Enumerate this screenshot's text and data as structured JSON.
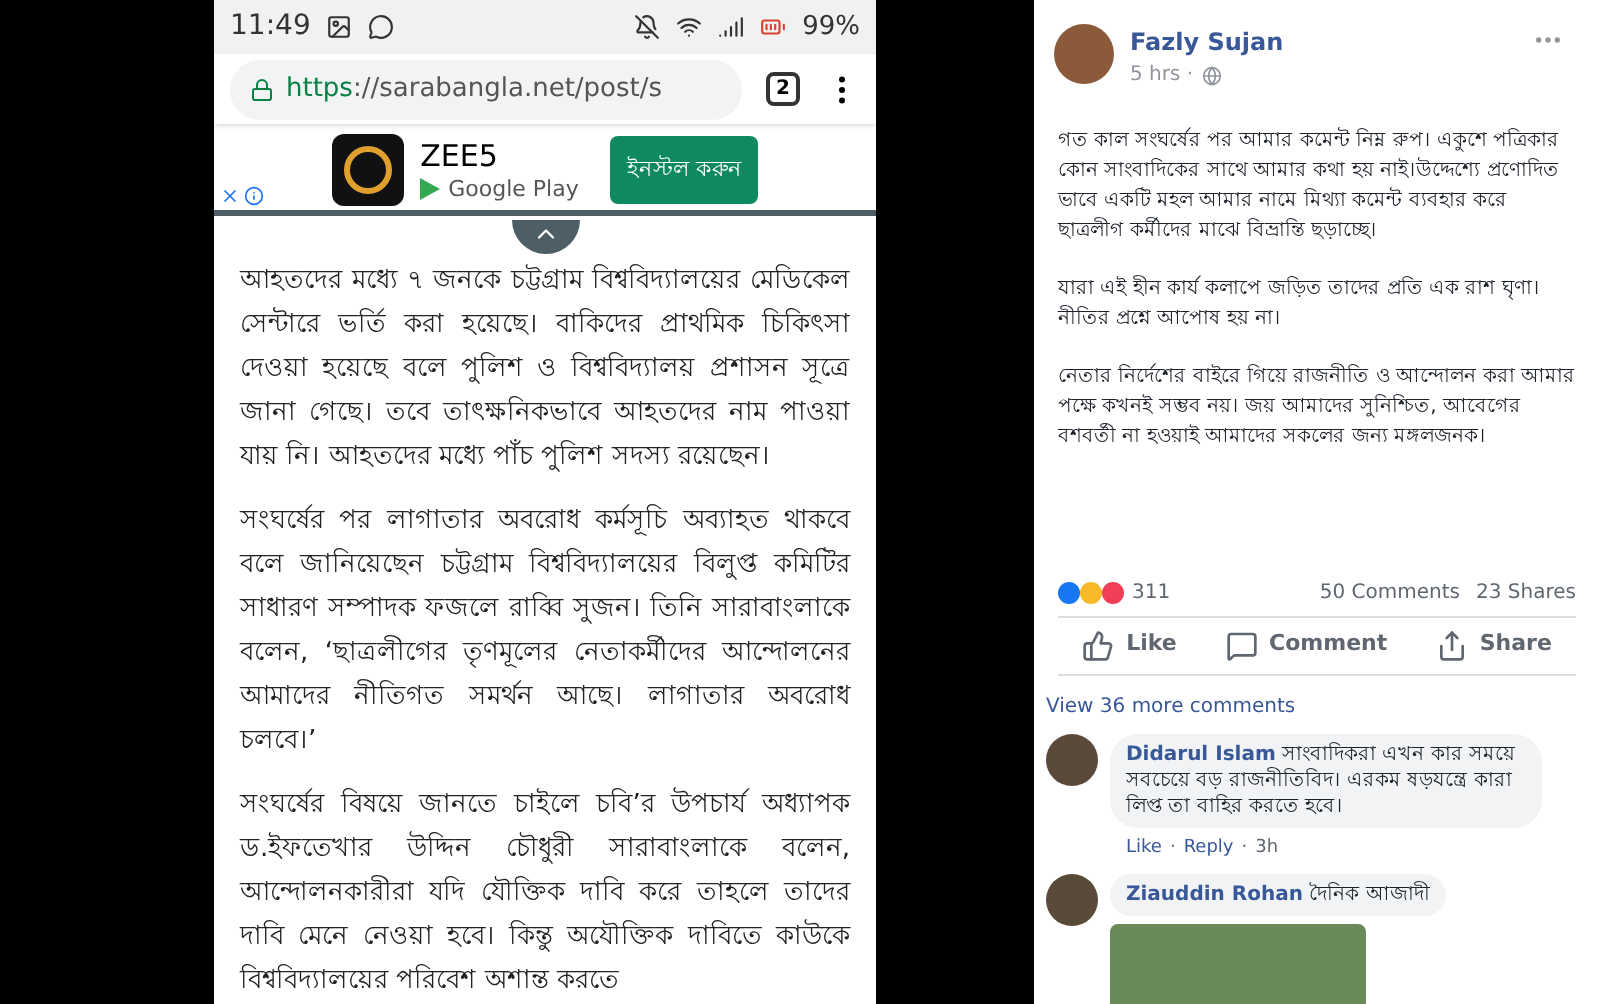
{
  "phone": {
    "status_bar": {
      "time": "11:49",
      "battery": "99%"
    },
    "browser": {
      "url_scheme": "https",
      "url_rest": "://sarabangla.net/post/s",
      "tab_count": "2"
    },
    "ad": {
      "app_name": "ZEE5",
      "store": "Google Play",
      "install_label": "ইনস্টল করুন"
    },
    "paragraphs": [
      "আহতদের মধ্যে ৭ জনকে চট্টগ্রাম বিশ্ববিদ্যালয়ের মেডিকেল সেন্টারে ভর্তি করা হয়েছে। বাকিদের প্রাথমিক চিকিৎসা দেওয়া হয়েছে বলে পুলিশ ও বিশ্ববিদ্যালয় প্রশাসন সূত্রে জানা গেছে। তবে তাৎক্ষনিকভাবে আহতদের নাম পাওয়া যায় নি। আহতদের মধ্যে পাঁচ পুলিশ সদস্য রয়েছেন।",
      "সংঘর্ষের পর লাগাতার অবরোধ কর্মসূচি অব্যাহত থাকবে বলে জানিয়েছেন চট্টগ্রাম বিশ্ববিদ্যালয়ের বিলুপ্ত কমিটির সাধারণ সম্পাদক ফজলে রাব্বি সুজন। তিনি সারাবাংলাকে বলেন, ‘ছাত্রলীগের তৃণমূলের নেতাকর্মীদের আন্দোলনের আমাদের নীতিগত সমর্থন আছে। লাগাতার অবরোধ চলবে।’",
      "সংঘর্ষের বিষয়ে জানতে চাইলে চবি’র উপচার্য অধ্যাপক ড.ইফতেখার উদ্দিন চৌধুরী সারাবাংলাকে বলেন, আন্দোলনকারীরা যদি যৌক্তিক দাবি করে তাহলে তাদের দাবি মেনে নেওয়া হবে। কিন্তু অযৌক্তিক দাবিতে কাউকে বিশ্ববিদ্যালয়ের পরিবেশ অশান্ত করতে"
    ]
  },
  "post": {
    "author": "Fazly Sujan",
    "time": "5 hrs ·",
    "paragraphs": [
      "গত কাল সংঘর্ষের পর আমার কমেন্ট নিম্ন রুপ। একুশে পত্রিকার কোন সাংবাদিকের সাথে আমার কথা হয় নাই।উদ্দেশ্যে প্রণোদিত ভাবে একটি মহল আমার নামে মিথ্যা কমেন্ট ব্যবহার করে ছাত্রলীগ কর্মীদের মাঝে বিভ্রান্তি ছড়াচ্ছে।",
      "যারা এই হীন কার্য কলাপে জড়িত তাদের প্রতি এক রাশ ঘৃণা। নীতির প্রশ্নে আপোষ হয় না।",
      "নেতার নির্দেশের বাইরে গিয়ে রাজনীতি ও আন্দোলন করা আমার পক্ষে কখনই সম্ভব নয়। জয় আমাদের সুনিশ্চিত, আবেগের বশবর্তী না হওয়াই আমাদের সকলের জন্য মঙ্গলজনক।"
    ],
    "reaction_count": "311",
    "comments_count": "50 Comments",
    "shares_count": "23 Shares",
    "actions": [
      {
        "kind": "like",
        "label": "Like"
      },
      {
        "kind": "comment",
        "label": "Comment"
      },
      {
        "kind": "share",
        "label": "Share"
      }
    ],
    "view_more": "View 36 more comments",
    "comments": [
      {
        "author": "Didarul Islam",
        "text": "সাংবাদিকরা এখন কার সময়ে সবচেয়ে বড় রাজনীতিবিদ। এরকম ষড়যন্ত্রে কারা লিপ্ত তা বাহির করতে হবে।",
        "like": "Like",
        "separator": "·",
        "reply": "Reply",
        "time": "3h",
        "has_photo": false
      },
      {
        "author": "Ziauddin Rohan",
        "text": "দৈনিক আজাদী",
        "has_photo": true
      }
    ]
  }
}
